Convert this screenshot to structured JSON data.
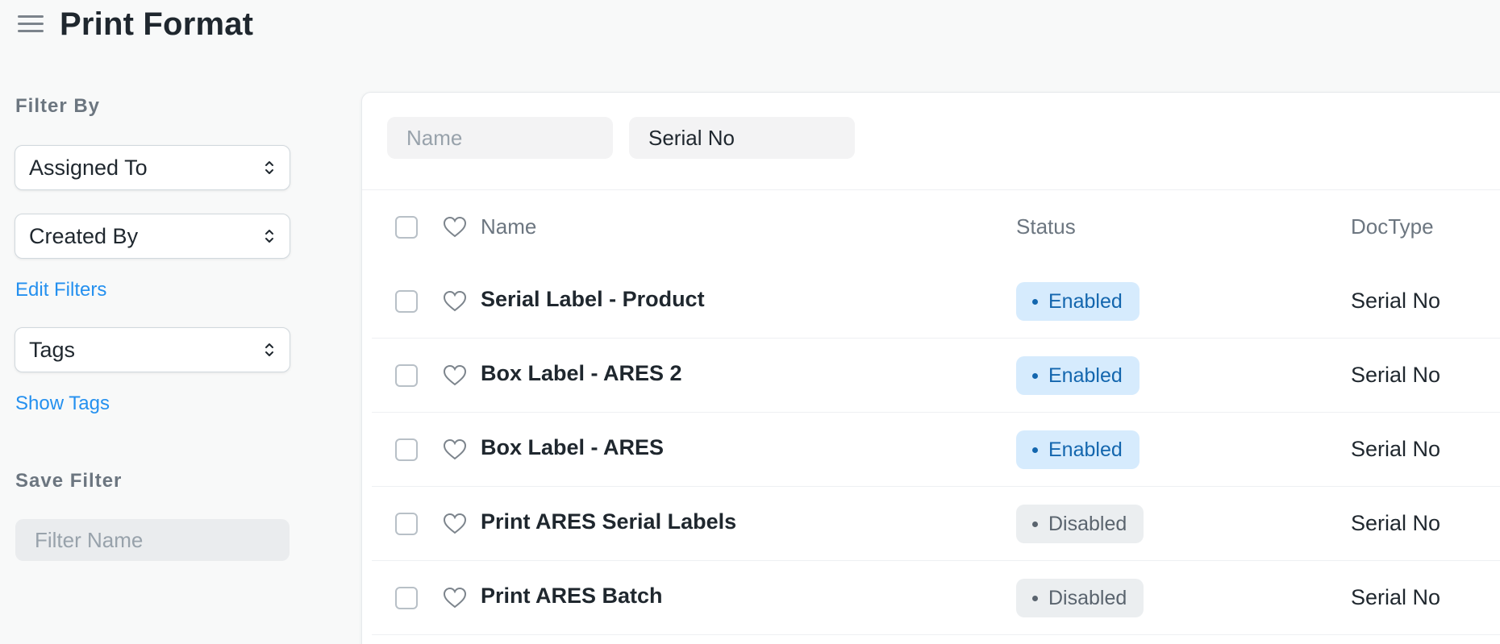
{
  "page": {
    "title": "Print Format"
  },
  "sidebar": {
    "filter_heading": "Filter By",
    "assigned_to": "Assigned To",
    "created_by": "Created By",
    "edit_filters": "Edit Filters",
    "tags": "Tags",
    "show_tags": "Show Tags",
    "save_filter_heading": "Save Filter",
    "filter_name_placeholder": "Filter Name"
  },
  "filters": {
    "name_placeholder": "Name",
    "doctype_value": "Serial No"
  },
  "list": {
    "columns": {
      "name": "Name",
      "status": "Status",
      "doctype": "DocType"
    },
    "rows": [
      {
        "name": "Serial Label - Product",
        "status": "Enabled",
        "doctype": "Serial No"
      },
      {
        "name": "Box Label - ARES 2",
        "status": "Enabled",
        "doctype": "Serial No"
      },
      {
        "name": "Box Label - ARES",
        "status": "Enabled",
        "doctype": "Serial No"
      },
      {
        "name": "Print ARES Serial Labels",
        "status": "Disabled",
        "doctype": "Serial No"
      },
      {
        "name": "Print ARES Batch",
        "status": "Disabled",
        "doctype": "Serial No"
      }
    ]
  },
  "colors": {
    "link": "#2490ef",
    "enabled_bg": "#d6ebfd",
    "enabled_text": "#1366ae",
    "disabled_bg": "#ebeef0",
    "disabled_text": "#5a646e"
  },
  "icons": {
    "menu": "hamburger-icon",
    "select_arrows": "up-down-arrows-icon",
    "like": "heart-icon",
    "select": "checkbox-icon"
  }
}
